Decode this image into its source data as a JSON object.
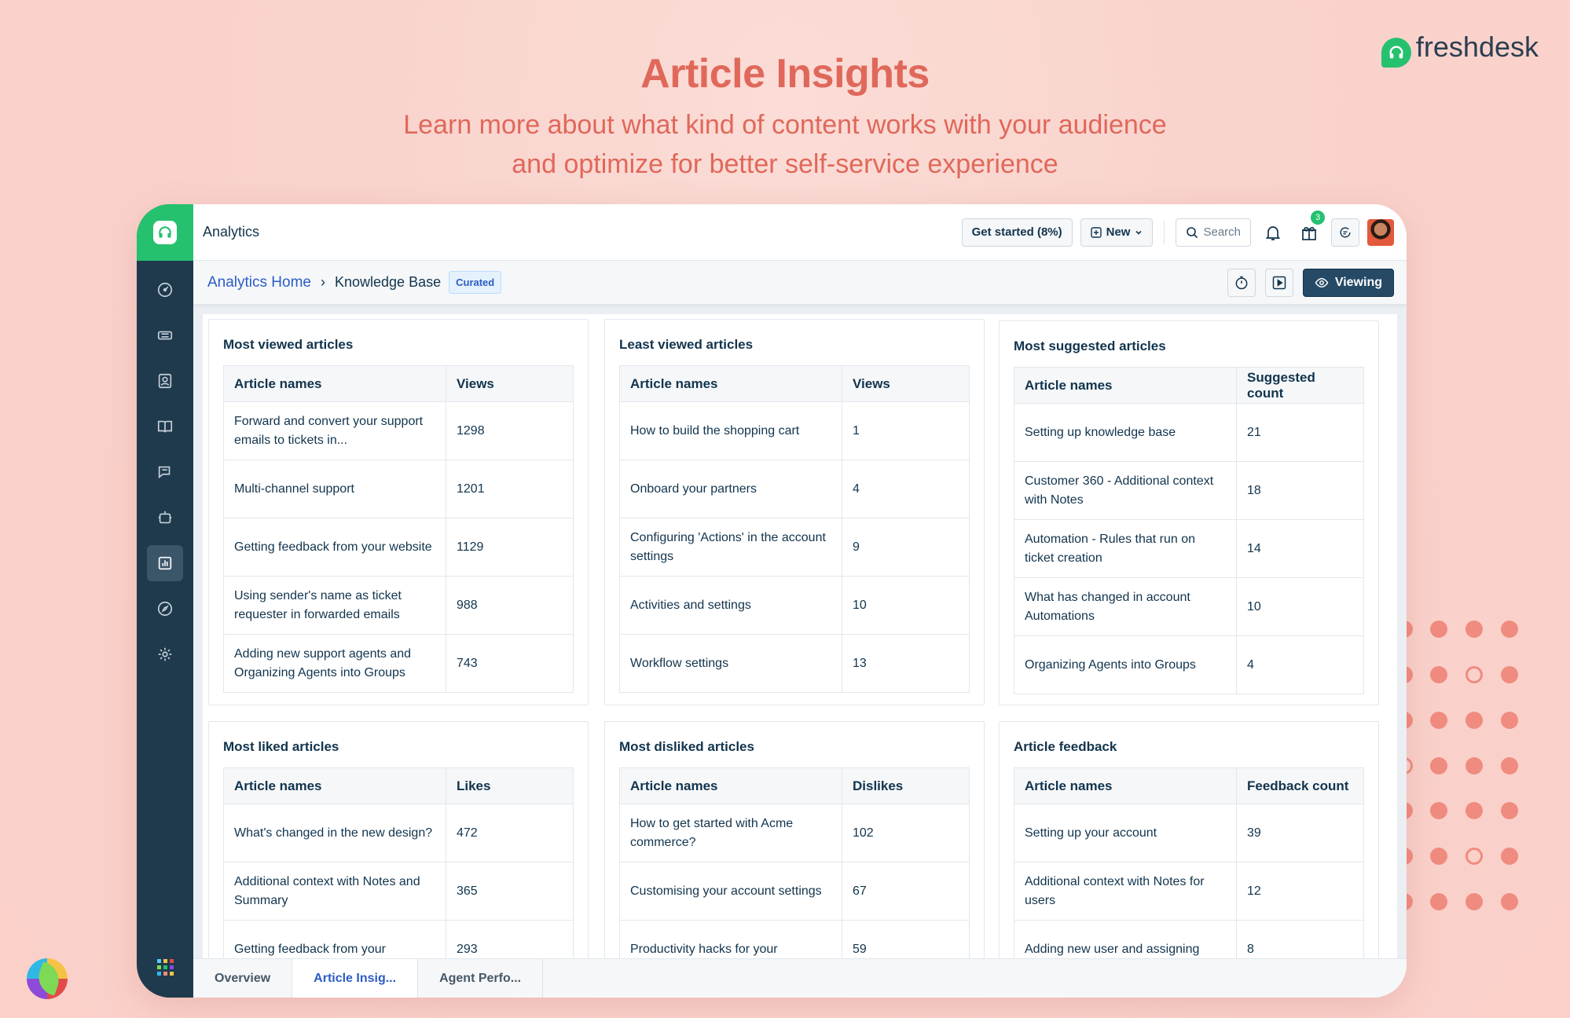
{
  "hero": {
    "title": "Article Insights",
    "subtitle_line1": "Learn more about what kind of content works with your audience",
    "subtitle_line2": "and optimize for better self-service experience"
  },
  "brand": {
    "name": "freshdesk"
  },
  "topbar": {
    "title": "Analytics",
    "get_started": "Get started (8%)",
    "new_label": "New",
    "search_placeholder": "Search",
    "gift_badge": "3"
  },
  "breadcrumb": {
    "home": "Analytics Home",
    "current": "Knowledge Base",
    "tag": "Curated",
    "viewing": "Viewing"
  },
  "cards": {
    "most_viewed": {
      "title": "Most viewed articles",
      "col1": "Article names",
      "col2": "Views",
      "rows": [
        {
          "name": "Forward and convert your support emails to tickets in...",
          "value": "1298"
        },
        {
          "name": "Multi-channel support",
          "value": "1201"
        },
        {
          "name": "Getting feedback from your website",
          "value": "1129"
        },
        {
          "name": "Using sender's name as ticket requester in forwarded emails",
          "value": "988"
        },
        {
          "name": "Adding new support agents and Organizing Agents into Groups",
          "value": "743"
        }
      ]
    },
    "least_viewed": {
      "title": "Least viewed articles",
      "col1": "Article names",
      "col2": "Views",
      "rows": [
        {
          "name": "How to build the shopping cart",
          "value": "1"
        },
        {
          "name": "Onboard your partners",
          "value": "4"
        },
        {
          "name": "Configuring 'Actions' in the account settings",
          "value": "9"
        },
        {
          "name": "Activities and settings",
          "value": "10"
        },
        {
          "name": "Workflow settings",
          "value": "13"
        }
      ]
    },
    "most_suggested": {
      "title": "Most suggested articles",
      "col1": "Article names",
      "col2": "Suggested count",
      "rows": [
        {
          "name": "Setting up knowledge base",
          "value": "21"
        },
        {
          "name": "Customer 360 - Additional context with Notes",
          "value": "18"
        },
        {
          "name": "Automation - Rules that run on ticket creation",
          "value": "14"
        },
        {
          "name": "What has changed in account Automations",
          "value": "10"
        },
        {
          "name": "Organizing Agents into Groups",
          "value": "4"
        }
      ]
    },
    "most_liked": {
      "title": "Most liked articles",
      "col1": "Article names",
      "col2": "Likes",
      "rows": [
        {
          "name": "What's changed in the new design?",
          "value": "472"
        },
        {
          "name": "Additional context with Notes and Summary",
          "value": "365"
        },
        {
          "name": "Getting feedback from your",
          "value": "293"
        }
      ]
    },
    "most_disliked": {
      "title": "Most disliked articles",
      "col1": "Article names",
      "col2": "Dislikes",
      "rows": [
        {
          "name": "How to get started with Acme commerce?",
          "value": "102"
        },
        {
          "name": "Customising your account settings",
          "value": "67"
        },
        {
          "name": "Productivity hacks for your",
          "value": "59"
        }
      ]
    },
    "feedback": {
      "title": "Article feedback",
      "col1": "Article names",
      "col2": "Feedback count",
      "rows": [
        {
          "name": "Setting up your account",
          "value": "39"
        },
        {
          "name": "Additional context with Notes for users",
          "value": "12"
        },
        {
          "name": "Adding new user and assigning",
          "value": "8"
        }
      ]
    }
  },
  "tabs": {
    "overview": "Overview",
    "article": "Article Insig...",
    "agent": "Agent Perfo..."
  },
  "colors": {
    "accent": "#e0685a",
    "sidebar": "#1f3a4d",
    "brand_green": "#25c16f",
    "link": "#2c5cc5"
  }
}
